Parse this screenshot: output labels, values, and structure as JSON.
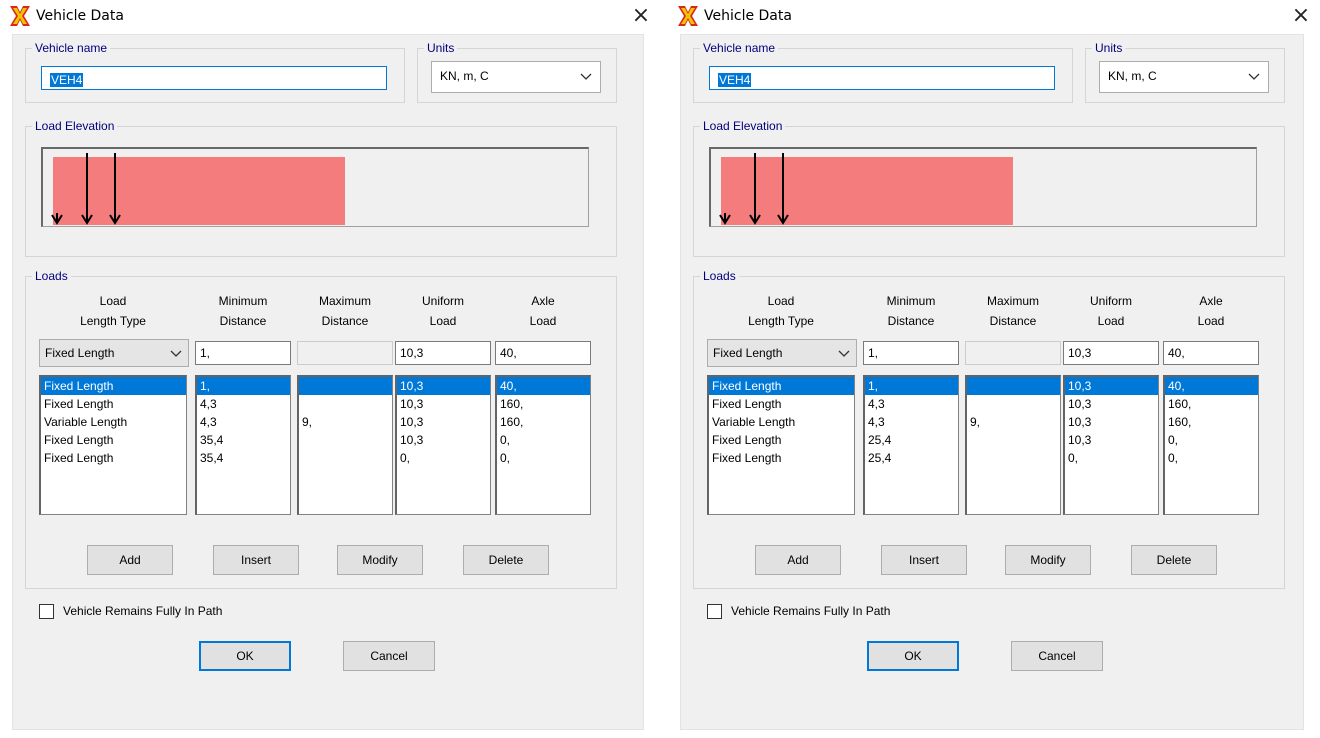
{
  "dialogs": [
    {
      "title": "Vehicle Data",
      "close_glyph": "×",
      "vehicle_name_label": "Vehicle name",
      "vehicle_name": "VEH4",
      "units_label": "Units",
      "units": "KN, m, C",
      "load_elevation_label": "Load Elevation",
      "loads_label": "Loads",
      "headers": [
        "Load\nLength Type",
        "Minimum\nDistance",
        "Maximum\nDistance",
        "Uniform\nLoad",
        "Axle\nLoad"
      ],
      "edit_row": {
        "type": "Fixed Length",
        "min": "1,",
        "max": "",
        "uniform": "10,3",
        "axle": "40,"
      },
      "rows": [
        {
          "type": "Fixed Length",
          "min": "1,",
          "max": "",
          "uniform": "10,3",
          "axle": "40,"
        },
        {
          "type": "Fixed Length",
          "min": "4,3",
          "max": "",
          "uniform": "10,3",
          "axle": "160,"
        },
        {
          "type": "Variable Length",
          "min": "4,3",
          "max": "9,",
          "uniform": "10,3",
          "axle": "160,"
        },
        {
          "type": "Fixed Length",
          "min": "35,4",
          "max": "",
          "uniform": "10,3",
          "axle": "0,"
        },
        {
          "type": "Fixed Length",
          "min": "35,4",
          "max": "",
          "uniform": "0,",
          "axle": "0,"
        }
      ],
      "selected_row": 0,
      "buttons": {
        "add": "Add",
        "insert": "Insert",
        "modify": "Modify",
        "delete": "Delete",
        "ok": "OK",
        "cancel": "Cancel"
      },
      "checkbox_label": "Vehicle Remains Fully In Path",
      "checkbox_checked": false
    },
    {
      "title": "Vehicle Data",
      "close_glyph": "×",
      "vehicle_name_label": "Vehicle name",
      "vehicle_name": "VEH4",
      "units_label": "Units",
      "units": "KN, m, C",
      "load_elevation_label": "Load Elevation",
      "loads_label": "Loads",
      "headers": [
        "Load\nLength Type",
        "Minimum\nDistance",
        "Maximum\nDistance",
        "Uniform\nLoad",
        "Axle\nLoad"
      ],
      "edit_row": {
        "type": "Fixed Length",
        "min": "1,",
        "max": "",
        "uniform": "10,3",
        "axle": "40,"
      },
      "rows": [
        {
          "type": "Fixed Length",
          "min": "1,",
          "max": "",
          "uniform": "10,3",
          "axle": "40,"
        },
        {
          "type": "Fixed Length",
          "min": "4,3",
          "max": "",
          "uniform": "10,3",
          "axle": "160,"
        },
        {
          "type": "Variable Length",
          "min": "4,3",
          "max": "9,",
          "uniform": "10,3",
          "axle": "160,"
        },
        {
          "type": "Fixed Length",
          "min": "25,4",
          "max": "",
          "uniform": "10,3",
          "axle": "0,"
        },
        {
          "type": "Fixed Length",
          "min": "25,4",
          "max": "",
          "uniform": "0,",
          "axle": "0,"
        }
      ],
      "selected_row": 0,
      "buttons": {
        "add": "Add",
        "insert": "Insert",
        "modify": "Modify",
        "delete": "Delete",
        "ok": "OK",
        "cancel": "Cancel"
      },
      "checkbox_label": "Vehicle Remains Fully In Path",
      "checkbox_checked": false
    }
  ],
  "colors": {
    "load_fill": "#f47c7c",
    "selection": "#0078d7",
    "group_label": "#00007b",
    "icon_red": "#d8281c",
    "icon_yellow": "#f5c400"
  },
  "icons": {
    "app": "sap-x-icon",
    "close": "close-icon",
    "dropdown": "chevron-down-icon",
    "load_arrow": "down-arrow-icon"
  }
}
